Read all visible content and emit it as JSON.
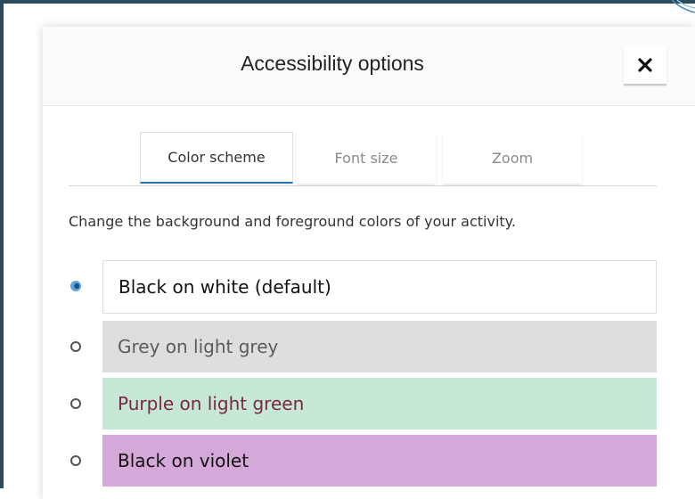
{
  "dialog": {
    "title": "Accessibility options",
    "close_label": "Close"
  },
  "tabs": [
    {
      "label": "Color scheme",
      "selected": true
    },
    {
      "label": "Font size",
      "selected": false
    },
    {
      "label": "Zoom",
      "selected": false
    }
  ],
  "description": "Change the background and foreground colors of your activity.",
  "options": [
    {
      "label": "Black on white (default)",
      "checked": true,
      "background": "#ffffff",
      "foreground": "#111111"
    },
    {
      "label": "Grey on light grey",
      "checked": false,
      "background": "#dedede",
      "foreground": "#5b5b5b"
    },
    {
      "label": "Purple on light green",
      "checked": false,
      "background": "#c6e8d4",
      "foreground": "#7a2745"
    },
    {
      "label": "Black on violet",
      "checked": false,
      "background": "#d4a8d8",
      "foreground": "#111111"
    }
  ],
  "colors": {
    "frame_border": "#2b4a5e",
    "accent": "#2a6fb5"
  }
}
